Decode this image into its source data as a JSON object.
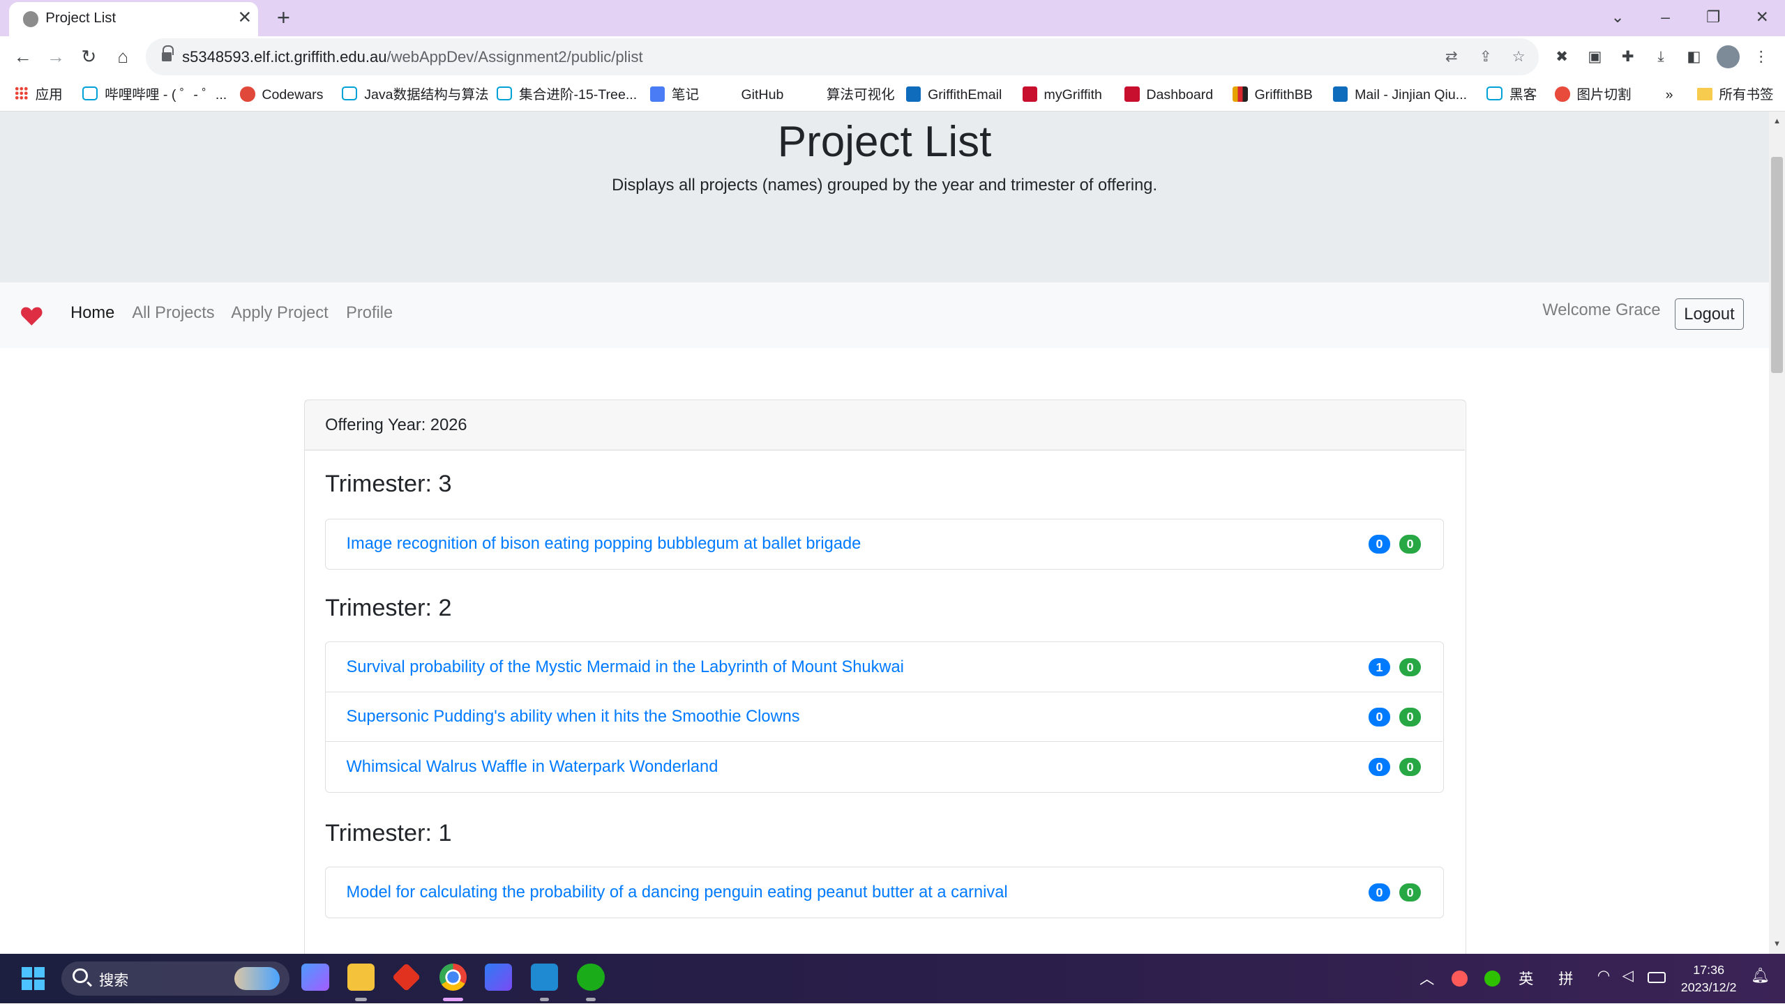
{
  "browser": {
    "tab_title": "Project List",
    "url_host": "s5348593.elf.ict.griffith.edu.au",
    "url_path": "/webAppDev/Assignment2/public/plist"
  },
  "bookmarks": [
    {
      "label": "应用",
      "icon": "apps-grid-icon"
    },
    {
      "label": "哔哩哔哩 - ( ゜- ゜...",
      "icon": "bilibili-icon"
    },
    {
      "label": "Codewars",
      "icon": "codewars-icon"
    },
    {
      "label": "Java数据结构与算法",
      "icon": "bilibili-icon"
    },
    {
      "label": "集合进阶-15-Tree...",
      "icon": "bilibili-icon"
    },
    {
      "label": "笔记",
      "icon": "note-icon"
    },
    {
      "label": "GitHub",
      "icon": "github-icon"
    },
    {
      "label": "算法可视化",
      "icon": "blank-icon"
    },
    {
      "label": "GriffithEmail",
      "icon": "outlook-icon"
    },
    {
      "label": "myGriffith",
      "icon": "griffith-icon"
    },
    {
      "label": "Dashboard",
      "icon": "griffith-icon"
    },
    {
      "label": "GriffithBB",
      "icon": "blackboard-icon"
    },
    {
      "label": "Mail - Jinjian Qiu...",
      "icon": "outlook-icon"
    },
    {
      "label": "黑客",
      "icon": "bilibili-icon"
    },
    {
      "label": "图片切割",
      "icon": "image-cut-icon"
    }
  ],
  "bookmarks_more": "»",
  "bookmarks_all": "所有书签",
  "jumbotron": {
    "title": "Project List",
    "lead": "Displays all projects (names) grouped by the year and trimester of offering."
  },
  "nav": {
    "links": [
      "Home",
      "All Projects",
      "Apply Project",
      "Profile"
    ],
    "welcome": "Welcome Grace",
    "logout": "Logout"
  },
  "offering": {
    "header": "Offering Year: 2026",
    "trimesters": [
      {
        "heading": "Trimester: 3",
        "projects": [
          {
            "name": "Image recognition of bison eating popping bubblegum at ballet brigade",
            "badge_primary": "0",
            "badge_success": "0"
          }
        ]
      },
      {
        "heading": "Trimester: 2",
        "projects": [
          {
            "name": "Survival probability of the Mystic Mermaid in the Labyrinth of Mount Shukwai",
            "badge_primary": "1",
            "badge_success": "0"
          },
          {
            "name": "Supersonic Pudding's ability when it hits the Smoothie Clowns",
            "badge_primary": "0",
            "badge_success": "0"
          },
          {
            "name": "Whimsical Walrus Waffle in Waterpark Wonderland",
            "badge_primary": "0",
            "badge_success": "0"
          }
        ]
      },
      {
        "heading": "Trimester: 1",
        "projects": [
          {
            "name": "Model for calculating the probability of a dancing penguin eating peanut butter at a carnival",
            "badge_primary": "0",
            "badge_success": "0"
          }
        ]
      }
    ]
  },
  "taskbar": {
    "search_placeholder": "搜索",
    "ime_lang": "英",
    "ime_mode": "拼",
    "time": "17:36",
    "date": "2023/12/2"
  },
  "colors": {
    "link": "#007bff",
    "badge_primary": "#007bff",
    "badge_success": "#28a745",
    "jumbotron_bg": "#e9ecef",
    "tabstrip_bg": "#e3d2f3"
  }
}
